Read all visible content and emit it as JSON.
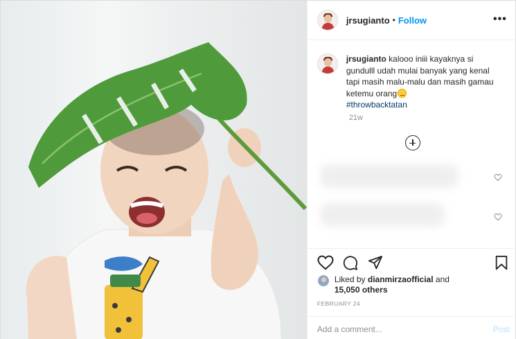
{
  "header": {
    "username": "jrsugianto",
    "separator": "•",
    "follow_label": "Follow",
    "more_label": "•••"
  },
  "caption": {
    "username": "jrsugianto",
    "text": "kalooo iniii kayaknya si gundulll udah mulai banyak yang kenal tapi masih malu-malu dan masih gamau ketemu orang",
    "emoji": "grinning-face-emoji",
    "hashtag": "#throwbacktatan",
    "time_ago": "21w"
  },
  "actions": {
    "icons": [
      "heart-icon",
      "comment-icon",
      "share-icon",
      "bookmark-icon"
    ]
  },
  "likes": {
    "prefix": "Liked by",
    "liked_by": "dianmirzaofficial",
    "and": "and",
    "others": "15,050 others"
  },
  "date": "FEBRUARY 24",
  "comment": {
    "placeholder": "Add a comment...",
    "post_label": "Post"
  },
  "colors": {
    "accent": "#0095f6",
    "hashtag": "#00376b",
    "muted": "#8e8e8e",
    "border": "#dbdbdb"
  }
}
